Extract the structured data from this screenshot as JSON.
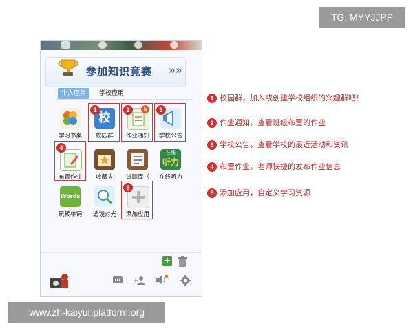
{
  "watermarks": {
    "tg": "TG: MYYJJPP",
    "url": "www.zh-kaiyunplatform.org"
  },
  "banner": {
    "title": "参加知识竞赛",
    "arrows": "»»"
  },
  "tabs": [
    {
      "label": "个人应用",
      "active": true
    },
    {
      "label": "学校应用",
      "active": false
    }
  ],
  "apps": [
    {
      "label": "学习书桌",
      "icon": "flower-book-icon"
    },
    {
      "label": "校园群",
      "icon": "campus-group-icon",
      "marker": "1",
      "tile_text": "校"
    },
    {
      "label": "作业通知",
      "icon": "homework-notice-icon",
      "marker": "2",
      "badge": "5"
    },
    {
      "label": "学校公告",
      "icon": "school-announcement-icon",
      "marker": "3"
    },
    {
      "label": "布置作业",
      "icon": "assign-homework-icon",
      "marker": "4"
    },
    {
      "label": "收藏夹",
      "icon": "favorites-star-icon"
    },
    {
      "label": "试题库（",
      "icon": "question-bank-icon"
    },
    {
      "label": "在线听力",
      "icon": "online-listening-icon",
      "tile_text_top": "在线",
      "tile_text": "听力"
    },
    {
      "label": "玩转单词",
      "icon": "words-icon",
      "tile_text": "Words"
    },
    {
      "label": "透镜对光",
      "icon": "lens-icon"
    },
    {
      "label": "添加应用",
      "icon": "add-app-plus-icon",
      "marker": "5"
    }
  ],
  "annotations": [
    {
      "num": "1",
      "text": "校园群，加入或创建学校组织的兴趣群吧！"
    },
    {
      "num": "2",
      "text": "作业通知，查看班级布置的作业"
    },
    {
      "num": "3",
      "text": "学校公告，查看学校的最近活动和资讯"
    },
    {
      "num": "4",
      "text": "布置作业，老师快捷的发布作业信息"
    },
    {
      "num": "5",
      "text": "添加应用，自定义学习资源"
    }
  ],
  "colors": {
    "marker_red": "#d32f2f",
    "annotation_red": "#c62828",
    "tab_blue": "#7fb2e5"
  }
}
